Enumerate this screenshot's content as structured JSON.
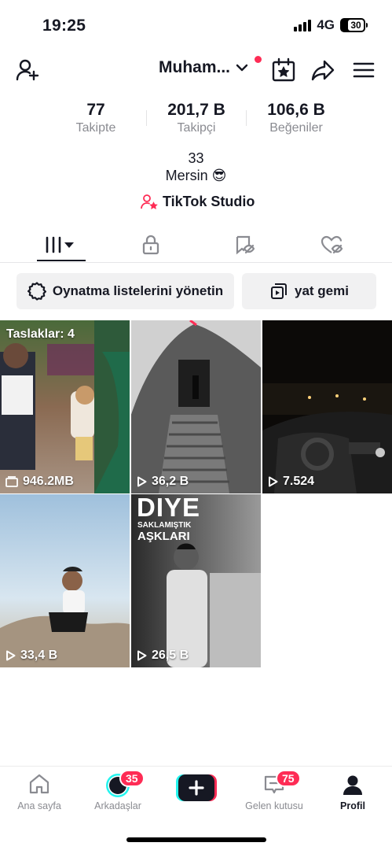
{
  "status_bar": {
    "time": "19:25",
    "network": "4G",
    "battery": "30"
  },
  "header": {
    "username": "Muham...",
    "icons": [
      "add-user-icon",
      "chevron-down-icon",
      "calendar-star-icon",
      "share-icon",
      "menu-icon"
    ]
  },
  "stats": [
    {
      "value": "77",
      "label": "Takipte"
    },
    {
      "value": "201,7 B",
      "label": "Takipçi"
    },
    {
      "value": "106,6 B",
      "label": "Beğeniler"
    }
  ],
  "bio": {
    "line1": "33",
    "line2": "Mersin 😎"
  },
  "studio": {
    "label": "TikTok Studio"
  },
  "tabs": [
    "videos-grid-icon",
    "lock-icon",
    "saved-icon",
    "liked-icon"
  ],
  "buttons": {
    "playlists": "Oynatma listelerini yönetin",
    "yat_gemi": "yat gemi"
  },
  "grid": {
    "drafts_label": "Taslaklar: 4",
    "items": [
      {
        "label": "946.2MB",
        "kind": "drafts"
      },
      {
        "label": "36,2 B",
        "kind": "views"
      },
      {
        "label": "7.524",
        "kind": "views"
      },
      {
        "label": "33,4 B",
        "kind": "views"
      },
      {
        "label": "26,5 B",
        "kind": "views"
      }
    ],
    "thumb5_text": {
      "title": "DIYE",
      "sub1": "SAKLAMIŞTIK",
      "sub2": "AŞKLARI"
    }
  },
  "bottom_nav": {
    "items": [
      {
        "label": "Ana sayfa"
      },
      {
        "label": "Arkadaşlar",
        "badge": "35"
      },
      {
        "label": ""
      },
      {
        "label": "Gelen kutusu",
        "badge": "75"
      },
      {
        "label": "Profil"
      }
    ]
  },
  "colors": {
    "accent": "#fe2c55",
    "text": "#161823",
    "muted": "#8a8b91",
    "button_bg": "#f1f1f2"
  }
}
